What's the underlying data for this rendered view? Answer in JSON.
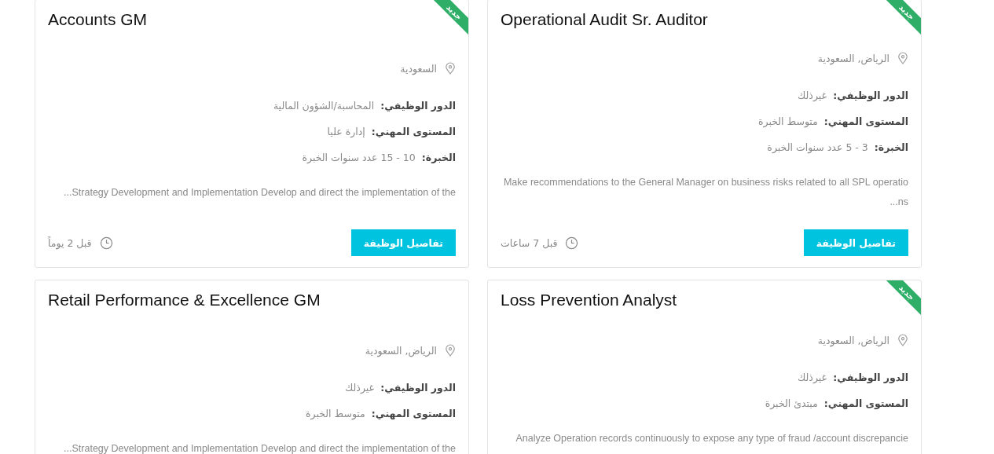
{
  "jobs": [
    {
      "title": "Operational Audit Sr. Auditor",
      "badge": "جديد",
      "location": "الرياض, السعودية",
      "fields": [
        {
          "label": "الدور الوظيفي:",
          "value": "غيرذلك"
        },
        {
          "label": "المستوى المهني:",
          "value": "متوسط الخبرة"
        },
        {
          "label": "الخبرة:",
          "value": "3 - 5 عدد سنوات الخبرة"
        }
      ],
      "description": "Make recommendations to the General Manager on business risks related to all SPL operations...",
      "button": "تفاصيل الوظيفة",
      "posted": "قبل 7 ساعات"
    },
    {
      "title": "Accounts GM",
      "badge": "جديد",
      "location": "السعودية",
      "fields": [
        {
          "label": "الدور الوظيفي:",
          "value": "المحاسبة/الشؤون المالية"
        },
        {
          "label": "المستوى المهني:",
          "value": "إدارة عليا"
        },
        {
          "label": "الخبرة:",
          "value": "10 - 15 عدد سنوات الخبرة"
        }
      ],
      "description": "Strategy Development and Implementation  Develop and direct the implementation of the...",
      "button": "تفاصيل الوظيفة",
      "posted": "قبل 2 يوماً"
    },
    {
      "title": "Loss Prevention Analyst",
      "badge": "جديد",
      "location": "الرياض, السعودية",
      "fields": [
        {
          "label": "الدور الوظيفي:",
          "value": "غيرذلك"
        },
        {
          "label": "المستوى المهني:",
          "value": "مبتدئ الخبرة"
        }
      ],
      "description": "Analyze Operation records continuously to expose any type of fraud /account discrepancie"
    },
    {
      "title": "Retail Performance & Excellence GM",
      "location": "الرياض, السعودية",
      "fields": [
        {
          "label": "الدور الوظيفي:",
          "value": "غيرذلك"
        },
        {
          "label": "المستوى المهني:",
          "value": "متوسط الخبرة"
        }
      ],
      "description": "Strategy Development and Implementation  Develop and direct the implementation of the..."
    }
  ]
}
